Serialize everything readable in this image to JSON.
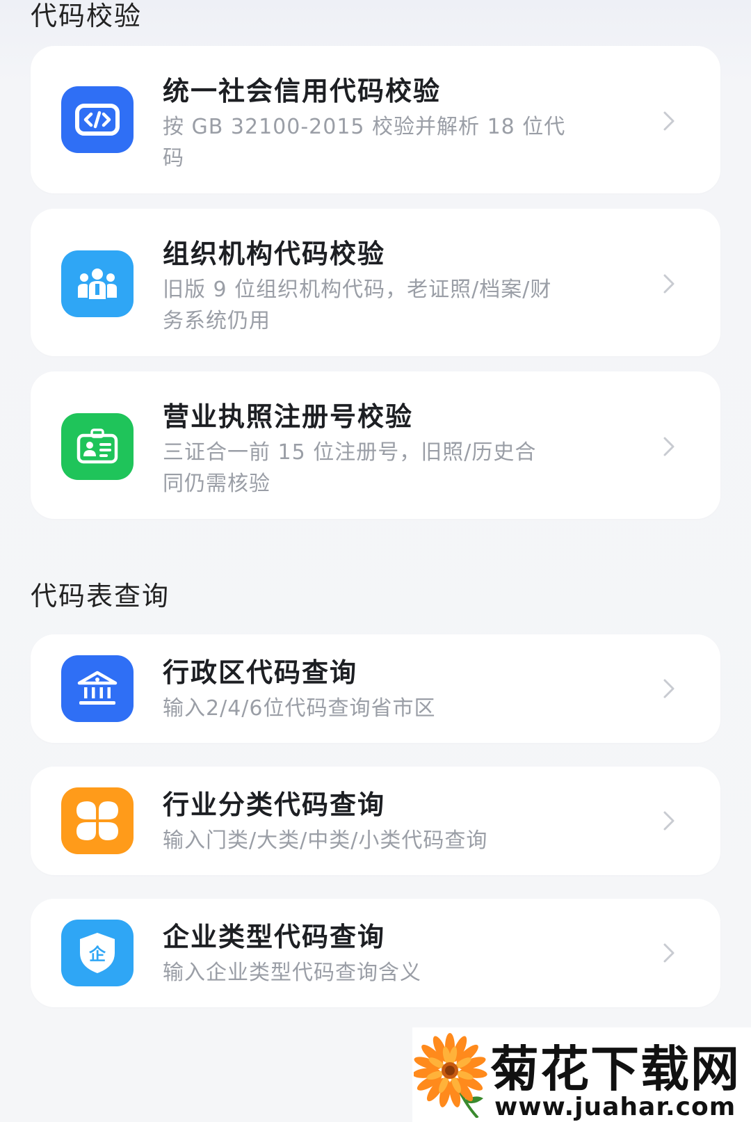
{
  "colors": {
    "blue": "#2f6ff5",
    "sky": "#2fa6f5",
    "green": "#1fc45a",
    "orange": "#ff9b1a",
    "desc_text": "#9a9ea6"
  },
  "sections": [
    {
      "title": "代码校验",
      "items": [
        {
          "title": "统一社会信用代码校验",
          "desc_lines": [
            "按 GB 32100-2015 校验并解析 18 位代",
            "码"
          ],
          "icon": "code-icon"
        },
        {
          "title": "组织机构代码校验",
          "desc_lines": [
            "旧版 9 位组织机构代码，老证照/档案/财",
            "务系统仍用"
          ],
          "icon": "people-group-icon"
        },
        {
          "title": "营业执照注册号校验",
          "desc_lines": [
            "三证合一前 15 位注册号，旧照/历史合",
            "同仍需核验"
          ],
          "icon": "id-card-icon"
        }
      ]
    },
    {
      "title": "代码表查询",
      "items": [
        {
          "title": "行政区代码查询",
          "desc_lines": [
            "输入2/4/6位代码查询省市区"
          ],
          "icon": "government-building-icon"
        },
        {
          "title": "行业分类代码查询",
          "desc_lines": [
            "输入门类/大类/中类/小类代码查询"
          ],
          "icon": "four-petal-grid-icon"
        },
        {
          "title": "企业类型代码查询",
          "desc_lines": [
            "输入企业类型代码查询含义"
          ],
          "icon": "enterprise-shield-icon",
          "icon_text": "企"
        }
      ]
    }
  ],
  "watermark": {
    "title": "菊花下载网",
    "url": "www.juahar.com",
    "icon": "chrysanthemum-logo-icon"
  }
}
